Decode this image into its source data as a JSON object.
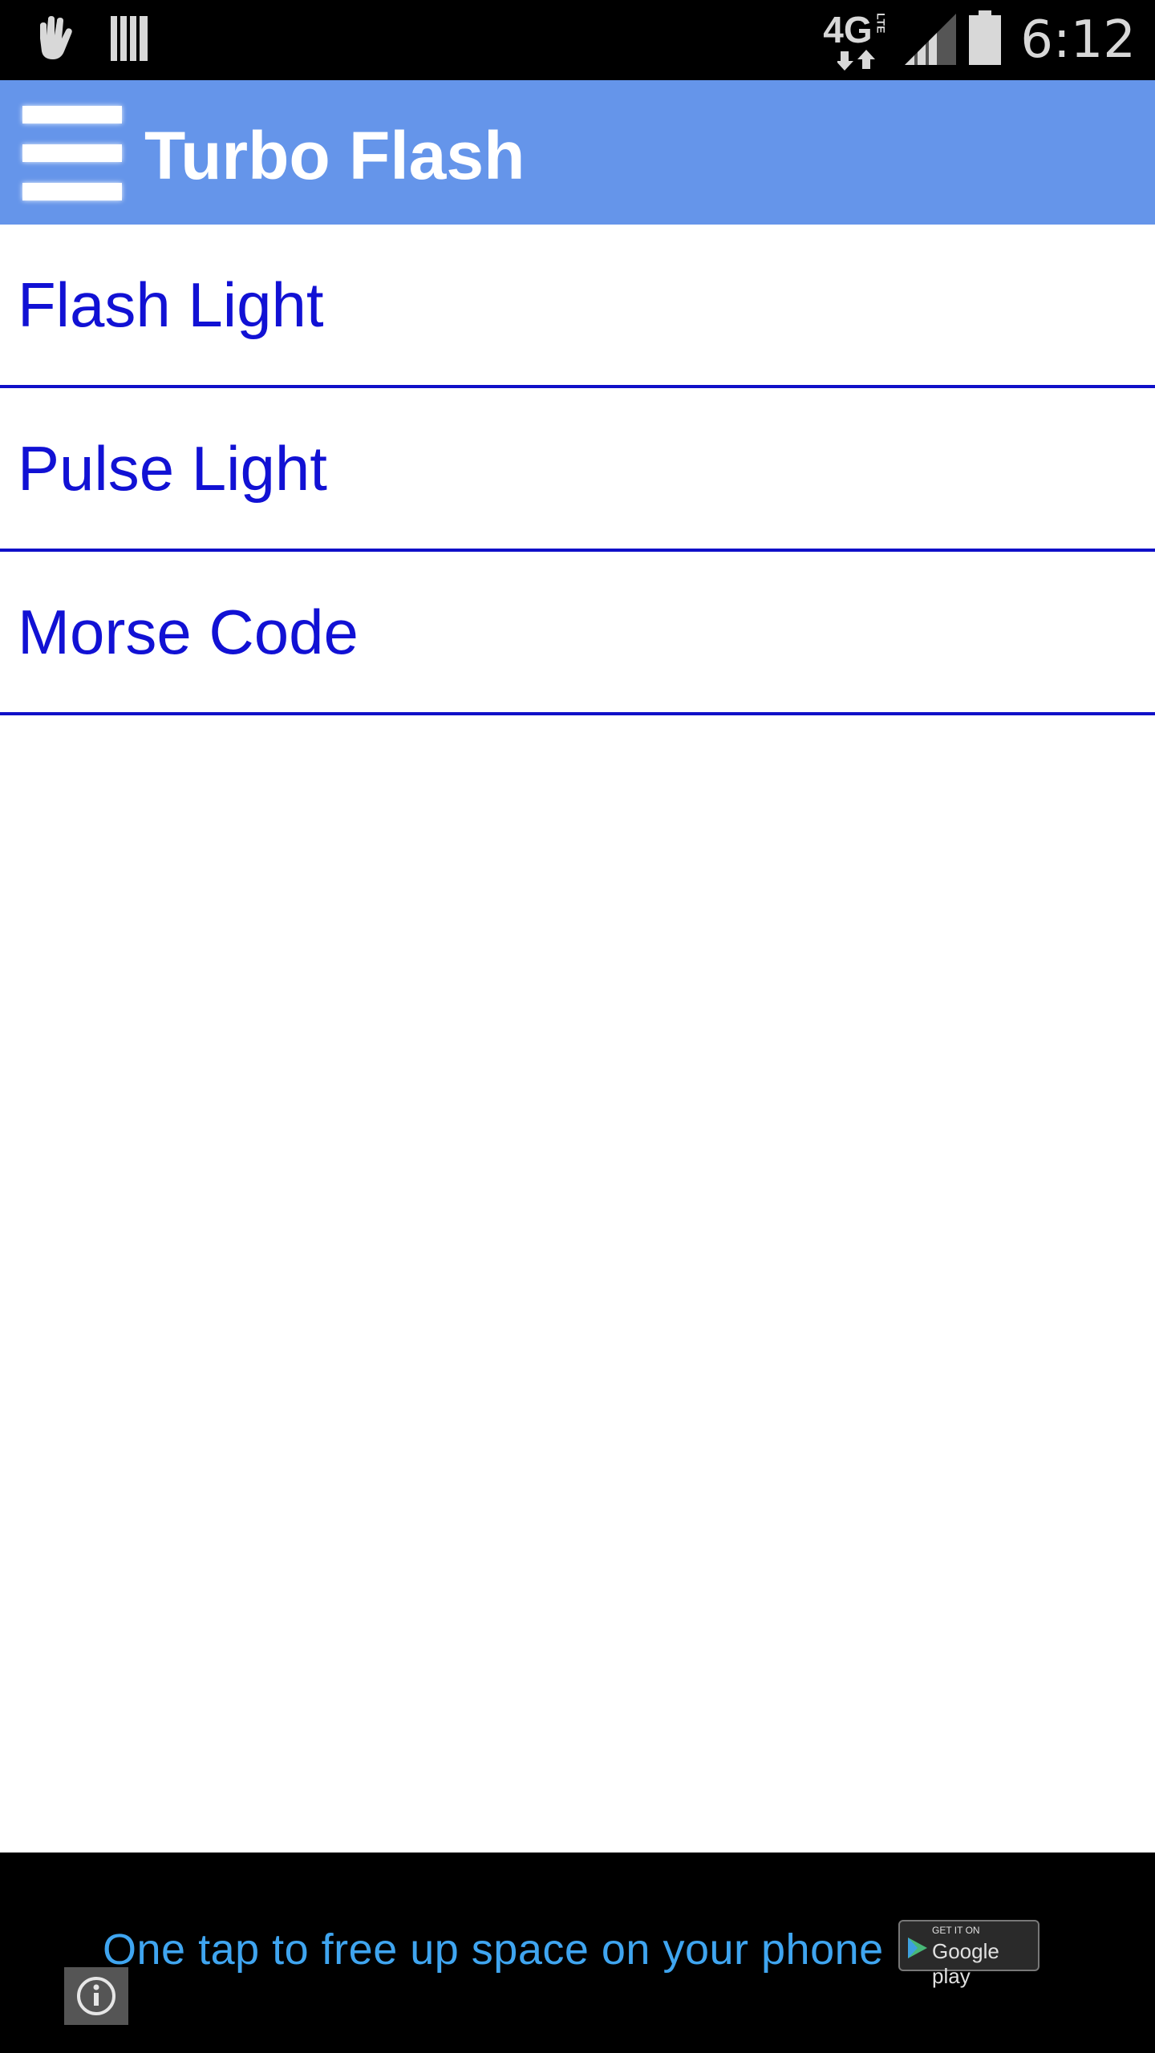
{
  "status_bar": {
    "time": "6:12",
    "network": "4G",
    "network_sub": "LTE",
    "icons": [
      "hand-icon",
      "barcode-icon",
      "network-icon",
      "signal-icon",
      "battery-icon"
    ]
  },
  "app_bar": {
    "title": "Turbo Flash",
    "color": "#6595ea",
    "menu_icon": "hamburger-menu-icon"
  },
  "menu": {
    "items": [
      {
        "label": "Flash Light"
      },
      {
        "label": "Pulse Light"
      },
      {
        "label": "Morse Code"
      }
    ],
    "text_color": "#1111d4"
  },
  "ad": {
    "text": "One tap to free up space on your phone",
    "badge_small": "GET IT ON",
    "badge_big": "Google play",
    "info_icon": "info-icon"
  }
}
